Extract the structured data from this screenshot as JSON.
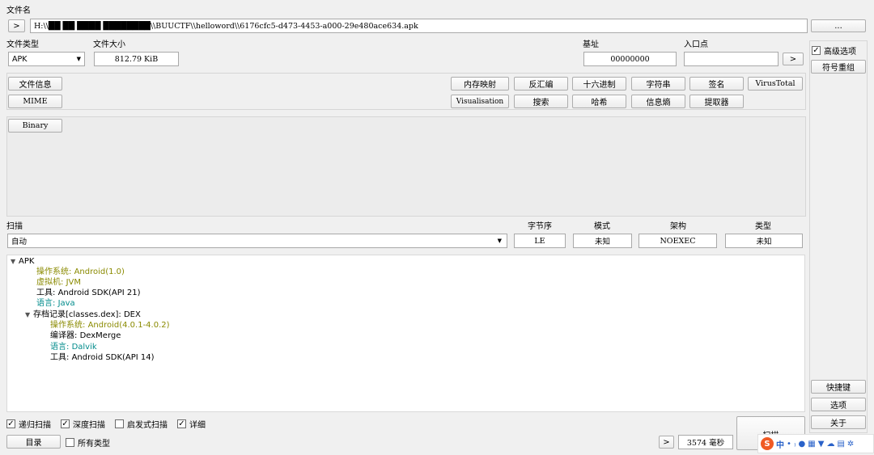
{
  "file": {
    "label": "文件名",
    "nav_label": ">",
    "path": "H:\\\\██ ██ ████ ████████\\\\BUUCTF\\\\helloword\\\\6176cfc5-d473-4453-a000-29e480ace634.apk",
    "browse_label": "..."
  },
  "filetype": {
    "label": "文件类型",
    "value": "APK",
    "arrow": "▼"
  },
  "filesize": {
    "label": "文件大小",
    "value": "812.79 KiB"
  },
  "base": {
    "label": "基址",
    "value": "00000000"
  },
  "entry": {
    "label": "入口点",
    "value": "",
    "nav_label": ">"
  },
  "tools": {
    "file_info": "文件信息",
    "mime": "MIME",
    "memory_map": "内存映射",
    "disasm": "反汇编",
    "hex": "十六进制",
    "strings": "字符串",
    "signature": "签名",
    "virustotal": "VirusTotal",
    "visualisation": "Visualisation",
    "search": "搜索",
    "hash": "哈希",
    "entropy": "信息熵",
    "extractor": "提取器"
  },
  "binary_tab": "Binary",
  "scan": {
    "label": "扫描",
    "mode": "自动",
    "arrow": "▼",
    "endian_label": "字节序",
    "endian": "LE",
    "mode_label": "模式",
    "mode_value": "未知",
    "arch_label": "架构",
    "arch": "NOEXEC",
    "type_label": "类型",
    "type": "未知"
  },
  "tree": {
    "root": "APK",
    "items": [
      {
        "key": "操作系统",
        "val": "Android(1.0)",
        "color": "#8a8a00"
      },
      {
        "key": "虚拟机",
        "val": "JVM",
        "color": "#8a8a00"
      },
      {
        "key": "工具",
        "val": "Android SDK(API 21)",
        "color": "#000000"
      },
      {
        "key": "语言",
        "val": "Java",
        "color": "#008b8b"
      }
    ],
    "archive": "存档记录[classes.dex]: DEX",
    "sub_items": [
      {
        "key": "操作系统",
        "val": "Android(4.0.1-4.0.2)",
        "color": "#8a8a00"
      },
      {
        "key": "编译器",
        "val": "DexMerge",
        "color": "#000000"
      },
      {
        "key": "语言",
        "val": "Dalvik",
        "color": "#008b8b"
      },
      {
        "key": "工具",
        "val": "Android SDK(API 14)",
        "color": "#000000"
      }
    ]
  },
  "options": {
    "recursive": "递归扫描",
    "deep": "深度扫描",
    "heuristic": "启发式扫描",
    "verbose": "详细",
    "directory": "目录",
    "all_types": "所有类型",
    "check": "✓"
  },
  "right_panel": {
    "advanced": "高级选项",
    "demangle": "符号重组",
    "shortcuts": "快捷键",
    "options": "选项",
    "about": "关于"
  },
  "bottom": {
    "nav_label": ">",
    "time": "3574 毫秒",
    "scan_button": "扫描"
  },
  "tray": {
    "brand": "S",
    "ime": "中",
    "extra": "• ₎"
  }
}
